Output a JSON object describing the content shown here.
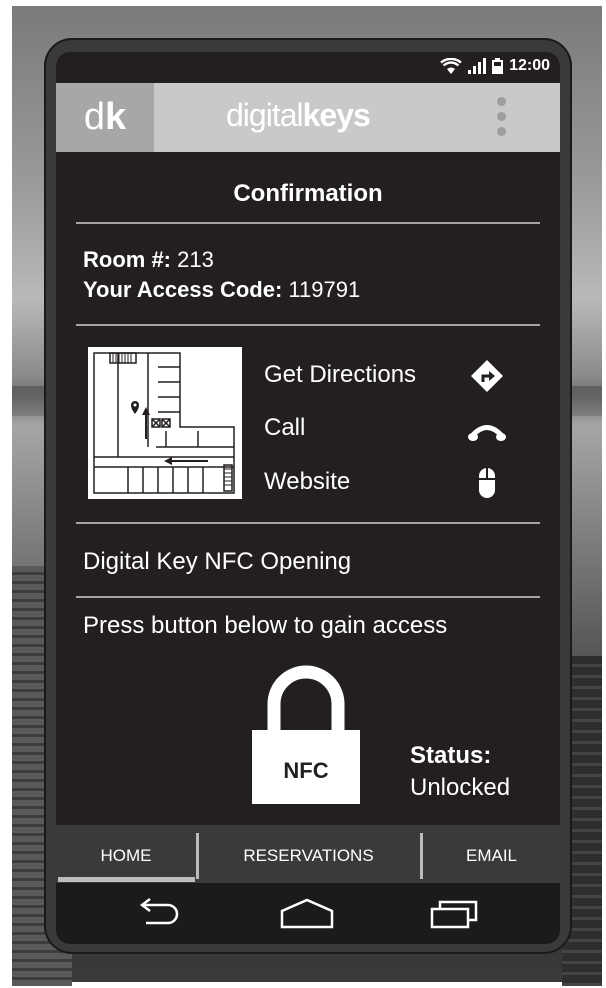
{
  "status_bar": {
    "time": "12:00",
    "icons": [
      "wifi-icon",
      "signal-icon",
      "battery-icon"
    ]
  },
  "app_bar": {
    "monogram_light": "d",
    "monogram_bold": "k",
    "logo_light": "digital",
    "logo_bold": "keys",
    "menu_icon": "overflow-menu-icon"
  },
  "page": {
    "title": "Confirmation"
  },
  "booking": {
    "room_label": "Room #:",
    "room_value": "213",
    "code_label": "Your Access Code:",
    "code_value": "119791"
  },
  "actions": [
    {
      "label": "Get Directions",
      "icon": "directions-icon"
    },
    {
      "label": "Call",
      "icon": "phone-icon"
    },
    {
      "label": "Website",
      "icon": "mouse-icon"
    }
  ],
  "nfc": {
    "section_title": "Digital Key NFC Opening",
    "instruction": "Press button below to gain access",
    "button_label": "NFC",
    "status_label": "Status:",
    "status_value": "Unlocked"
  },
  "tabs": [
    {
      "label": "HOME",
      "active": true
    },
    {
      "label": "RESERVATIONS",
      "active": false
    },
    {
      "label": "EMAIL",
      "active": false
    }
  ],
  "nav_buttons": [
    "back-icon",
    "home-icon",
    "recent-apps-icon"
  ],
  "colors": {
    "screen": "#231f20",
    "app_bar": "#c9c9c9",
    "tab_bar": "#3a3a3a",
    "nav_bar": "#1b1b1b"
  }
}
